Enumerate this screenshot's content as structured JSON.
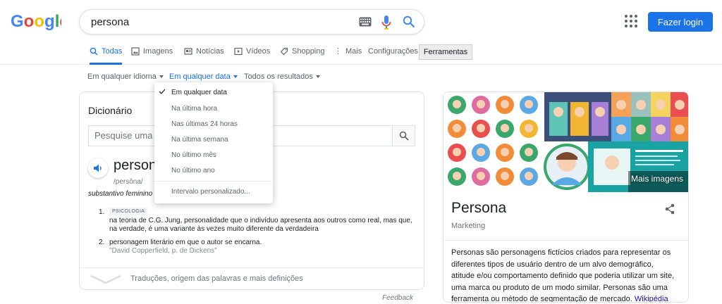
{
  "logo": {
    "text": "Google"
  },
  "search": {
    "query": "persona"
  },
  "header": {
    "login_label": "Fazer login"
  },
  "tabs": [
    {
      "label": "Todas",
      "icon": "search-icon"
    },
    {
      "label": "Imagens",
      "icon": "image-icon"
    },
    {
      "label": "Notícias",
      "icon": "news-icon"
    },
    {
      "label": "Vídeos",
      "icon": "video-icon"
    },
    {
      "label": "Shopping",
      "icon": "tag-icon"
    },
    {
      "label": "Mais",
      "icon": "more-icon"
    },
    {
      "label": "Configurações"
    },
    {
      "label": "Ferramentas"
    }
  ],
  "filters": {
    "language": "Em qualquer idioma",
    "date": "Em qualquer data",
    "results": "Todos os resultados"
  },
  "date_menu": {
    "items": [
      "Em qualquer data",
      "Na última hora",
      "Nas últimas 24 horas",
      "Na última semana",
      "No último mês",
      "No último ano"
    ],
    "custom": "Intervalo personalizado..."
  },
  "dictionary": {
    "title": "Dicionário",
    "search_placeholder": "Pesquise uma palavra",
    "word": "persona",
    "phonetic": "/persôna/",
    "part_of_speech": "substantivo feminino",
    "definitions": [
      {
        "number": "1.",
        "tag": "PSICOLOGIA",
        "text": "na teoria de C.G. Jung, personalidade que o indivíduo apresenta aos outros como real, mas que, na verdade, é uma variante às vezes muito diferente da verdadeira"
      },
      {
        "number": "2.",
        "text": "personagem literário em que o autor se encarna.",
        "quote": "\"David Copperfield, p. de Dickens\""
      }
    ],
    "more": "Traduções, origem das palavras e mais definições",
    "feedback": "Feedback"
  },
  "knowledge_panel": {
    "title": "Persona",
    "subtitle": "Marketing",
    "more_images": "Mais imagens",
    "description": "Personas são personagens fictícios criados para representar os diferentes tipos de usuário dentro de um alvo demográfico, atitude e/ou comportamento definido que poderia utilizar um site, uma marca ou produto de um modo similar. Personas são uma ferramenta ou método de segmentação de mercado.",
    "source_link": "Wikipédia"
  },
  "colors": {
    "accent": "#1a73e8",
    "link": "#1a0dab"
  }
}
